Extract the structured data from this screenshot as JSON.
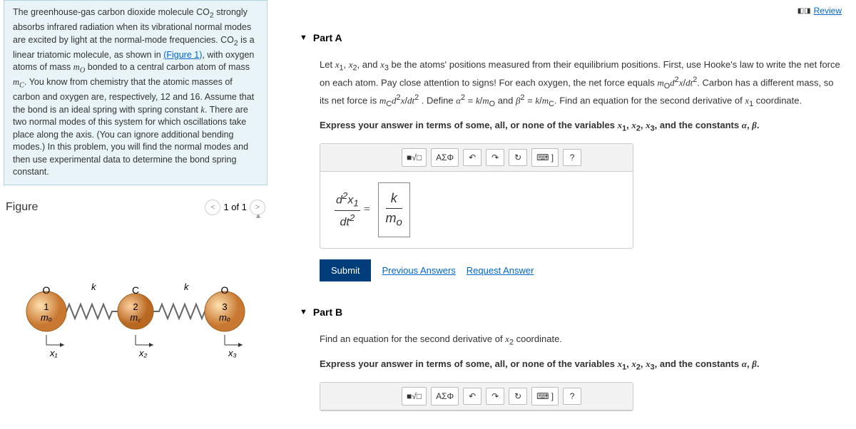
{
  "review_label": "Review",
  "problem_text": {
    "p1a": "The greenhouse-gas carbon dioxide molecule CO",
    "p1b": " strongly absorbs infrared radiation when its vibrational normal modes are excited by light at the normal-mode frequencies. CO",
    "p1c": " is a linear triatomic molecule, as shown in ",
    "fig_link": "(Figure 1)",
    "p1d": ", with oxygen atoms of mass ",
    "mO": "m",
    "p1e": " bonded to a central carbon atom of mass ",
    "mC": "m",
    "p1f": ". You know from chemistry that the atomic masses of carbon and oxygen are, respectively, 12 and 16. Assume that the bond is an ideal spring with spring constant ",
    "k": "k",
    "p1g": ". There are two normal modes of this system for which oscillations take place along the axis. (You can ignore additional bending modes.) In this problem, you will find the normal modes and then use experimental data to determine the bond spring constant."
  },
  "figure": {
    "title": "Figure",
    "counter": "1 of 1",
    "prev": "<",
    "next": ">"
  },
  "partA": {
    "label": "Part A",
    "text": "Let x₁, x₂, and x₃ be the atoms' positions measured from their equilibrium positions. First, use Hooke's law to write the net force on each atom. Pay close attention to signs! For each oxygen, the net force equals mₒd²x/dt². Carbon has a different mass, so its net force is m꜀d²x/dt². Define α² = k/mₒ and β² = k/m꜀. Find an equation for the second derivative of x₁ coordinate.",
    "instruction": "Express your answer in terms of some, all, or none of the variables x₁, x₂, x₃, and the constants α, β.",
    "lhs": "d²x₁/dt² =",
    "answer": "k / mₒ",
    "submit": "Submit",
    "prev_answers": "Previous Answers",
    "request": "Request Answer"
  },
  "partB": {
    "label": "Part B",
    "text": "Find an equation for the second derivative of x₂ coordinate.",
    "instruction": "Express your answer in terms of some, all, or none of the variables x₁, x₂, x₃, and the constants α, β."
  },
  "toolbar": {
    "templates": "■√□",
    "greek": "ΑΣΦ",
    "undo": "↶",
    "redo": "↷",
    "reset": "↻",
    "keyboard": "⌨ ]",
    "help": "?"
  }
}
